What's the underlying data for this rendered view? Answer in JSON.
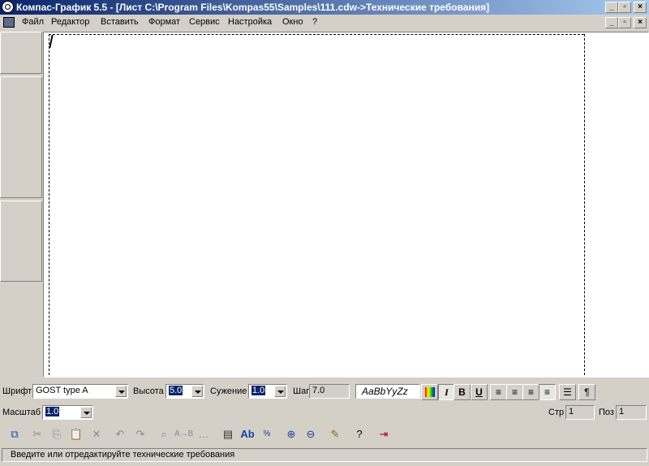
{
  "window": {
    "title": "Компас-График 5.5 - [Лист C:\\Program Files\\Kompas55\\Samples\\111.cdw->Технические требования]",
    "caption_buttons": [
      "_",
      "▫",
      "×"
    ]
  },
  "menubar": {
    "items": [
      "Файл",
      "Редактор",
      "Вставить",
      "Формат",
      "Сервис",
      "Настройка",
      "Окно",
      "?"
    ]
  },
  "text_toolbar": {
    "font_label": "Шрифт",
    "font_value": "GOST type A",
    "height_label": "Высота",
    "height_value": "5.0",
    "narrow_label": "Сужение",
    "narrow_value": "1.0",
    "step_label": "Шаг",
    "step_value": "7.0",
    "sample_text": "AaBbYyZz",
    "bold_glyph": "B",
    "italic_glyph": "I",
    "underline_glyph": "U",
    "paragraph_glyph": "¶"
  },
  "scale_bar": {
    "scale_label": "Масштаб",
    "scale_value": "1.0",
    "row_label": "Стр",
    "row_value": "1",
    "pos_label": "Поз",
    "pos_value": "1"
  },
  "main_toolbar": {
    "spell_label": "Ab",
    "icons": [
      "switch-mode-icon",
      "cut-icon",
      "copy-icon",
      "paste-icon",
      "delete-icon",
      "undo-icon",
      "redo-icon",
      "find-icon",
      "replace-icon",
      "find-next-icon",
      "text-template-icon",
      "spellcheck-icon",
      "special-symbol-icon",
      "zoom-in-icon",
      "zoom-out-icon",
      "pen-icon",
      "help-pointer-icon",
      "exit-icon"
    ]
  },
  "status": {
    "message": "Введите или отредактируйте технические требования"
  },
  "colors": {
    "titlebar_start": "#0a246a",
    "titlebar_end": "#a6caf0",
    "face": "#d4d0c8",
    "selection": "#0a246a"
  }
}
